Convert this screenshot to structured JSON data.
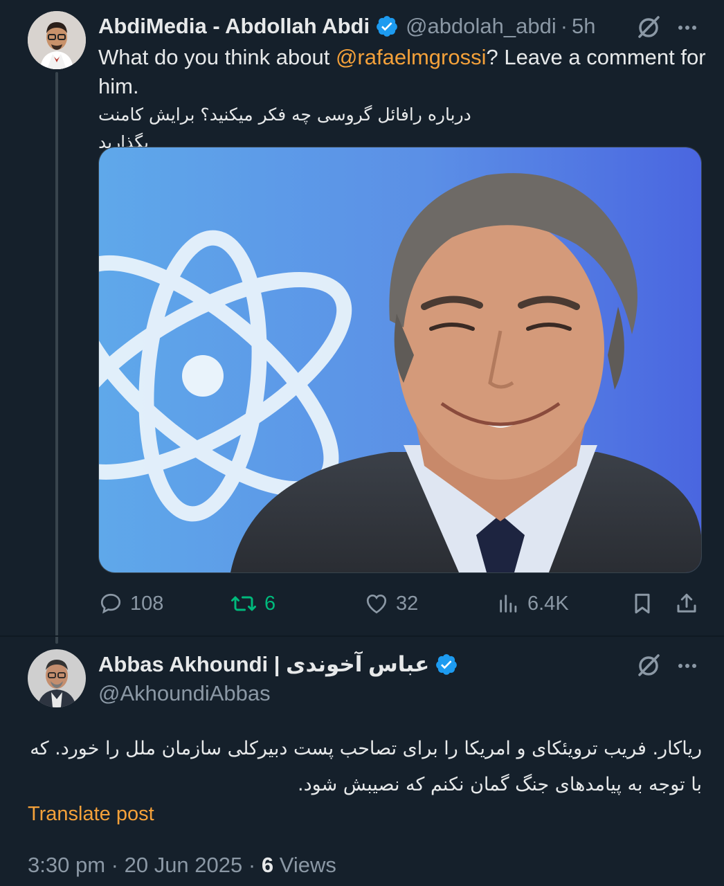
{
  "colors": {
    "background": "#15202b",
    "accent_link": "#f4a13a",
    "verified_blue": "#1d9bf0",
    "retweet_green": "#00ba7c",
    "muted": "#8b98a5"
  },
  "tweet1": {
    "display_name": "AbdiMedia - Abdollah Abdi",
    "handle": "@abdolah_abdi",
    "separator": "·",
    "time": "5h",
    "text_before": "What do you think about ",
    "mention": "@rafaelmgrossi",
    "text_after": "? Leave a comment for him.",
    "farsi_text": "درباره رافائل گروسی چه فکر میکنید؟ برایش کامنت بگذارید",
    "icons": [
      "verified-badge-icon",
      "grok-icon",
      "more-options-icon"
    ],
    "actions": {
      "replies": "108",
      "reposts": "6",
      "likes": "32",
      "views": "6.4K"
    }
  },
  "tweet2": {
    "display_name": "Abbas Akhoundi | عباس آخوندی",
    "handle": "@AkhoundiAbbas",
    "text": "ریاکار. فریب ترویئکای و امریکا را برای تصاحب پست دبیرکلی سازمان ملل را خورد. که با توجه به پیامدهای جنگ گمان نکنم که نصیبش شود.",
    "translate_label": "Translate post",
    "time": "3:30 pm",
    "date": "20 Jun 2025",
    "separator": "·",
    "views_count": "6",
    "views_label": "Views"
  }
}
